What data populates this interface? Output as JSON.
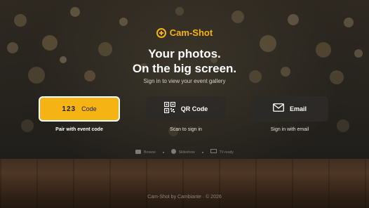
{
  "app": {
    "brand": "Cam-Shot",
    "accent_color": "#f5b413"
  },
  "hero": {
    "headline_line1": "Your photos.",
    "headline_line2": "On the big screen.",
    "subtitle": "Sign in to view your event gallery"
  },
  "signin_options": [
    {
      "icon_text": "123",
      "icon": "number-pad-icon",
      "label": "Code",
      "caption": "Pair with event code",
      "selected": true
    },
    {
      "icon": "qr-code-icon",
      "label": "QR Code",
      "caption": "Scan to sign in",
      "selected": false
    },
    {
      "icon": "envelope-icon",
      "label": "Email",
      "caption": "Sign in with email",
      "selected": false
    }
  ],
  "features": [
    {
      "icon": "image-icon",
      "label": "Browse"
    },
    {
      "icon": "play-icon",
      "label": "Slideshow"
    },
    {
      "icon": "tv-icon",
      "label": "TV-ready"
    }
  ],
  "footer": {
    "text": "Cam-Shot by Cambiante · © 2026"
  }
}
